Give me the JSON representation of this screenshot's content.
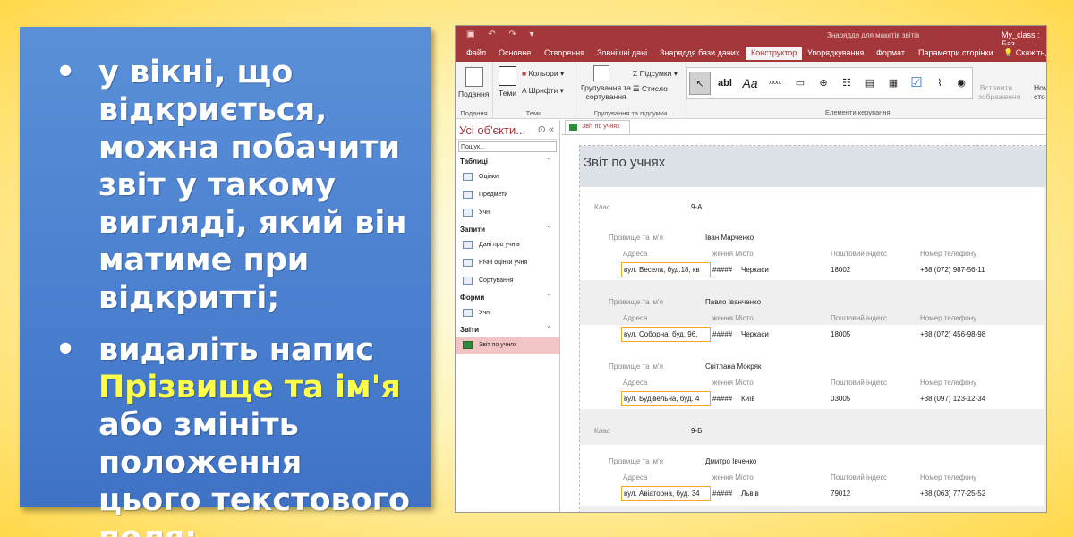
{
  "slide": {
    "bullets": [
      {
        "text": "у вікні, що відкриється, можна побачити звіт у такому вигляді, який він матиме при відкритті;"
      },
      {
        "before": "видаліть напис ",
        "highlight": "Прізвище та ім'я",
        "after": " або змініть положення цього текстового поля;"
      }
    ],
    "bullet_char": "•",
    "highlight_color": "#ffff4a"
  },
  "access": {
    "title_ctx": "Знаряддя для макетів звітів",
    "title_file": "My_class : Баз",
    "tabs": [
      "Файл",
      "Основне",
      "Створення",
      "Зовнішні дані",
      "Знаряддя бази даних",
      "Конструктор",
      "Упорядкування",
      "Формат",
      "Параметри сторінки"
    ],
    "tell_me": "Скажіть, в",
    "ribbon": {
      "view": "Подання",
      "themes": "Теми",
      "colors": "Кольори",
      "fonts": "Шрифти",
      "group_views": "Подання",
      "group_themes": "Теми",
      "grouping": "Групування та сортування",
      "totals": "Підсумки",
      "hide_details": "Стисло",
      "group_grouping": "Групування та підсумки",
      "group_controls": "Елементи керування",
      "insert_image": "Вставити зображення",
      "page_numbers": "Номе сто"
    },
    "nav": {
      "title": "Усі об'єкти...",
      "search_placeholder": "Пошук...",
      "sections": [
        {
          "name": "Таблиці",
          "items": [
            "Оцінки",
            "Предмети",
            "Учні"
          ]
        },
        {
          "name": "Запити",
          "items": [
            "Дані про учнів",
            "Річні оцінки учня",
            "Сортування"
          ]
        },
        {
          "name": "Форми",
          "items": [
            "Учні"
          ]
        },
        {
          "name": "Звіти",
          "items": [
            "Звіт по учнях"
          ]
        }
      ]
    },
    "doc_tab": "Звіт по учнях",
    "report": {
      "title": "Звіт по учнях",
      "class_label": "Клас",
      "name_label": "Прізвище та ім'я",
      "addr_label": "Адреса",
      "city_label": "ження Місто",
      "zip_label": "Поштовий індекс",
      "phone_label": "Номер телефону",
      "class1": "9-А",
      "class2": "9-Б",
      "hash": "#####",
      "students": [
        {
          "name": "Іван Марченко",
          "addr": "вул. Весела, буд.18, кв",
          "city": "Черкаси",
          "zip": "18002",
          "phone": "+38 (072) 987-56-11"
        },
        {
          "name": "Павло Іванченко",
          "addr": "вул. Соборна, буд. 96,",
          "city": "Черкаси",
          "zip": "18005",
          "phone": "+38 (072) 456-98-98"
        },
        {
          "name": "Світлана Мокряк",
          "addr": "вул. Будівельна, буд. 4",
          "city": "Київ",
          "zip": "03005",
          "phone": "+38 (097) 123-12-34"
        },
        {
          "name": "Дмитро Івченко",
          "addr": "вул. Авіаторна, буд. 34",
          "city": "Львів",
          "zip": "79012",
          "phone": "+38 (063) 777-25-52"
        }
      ]
    }
  }
}
